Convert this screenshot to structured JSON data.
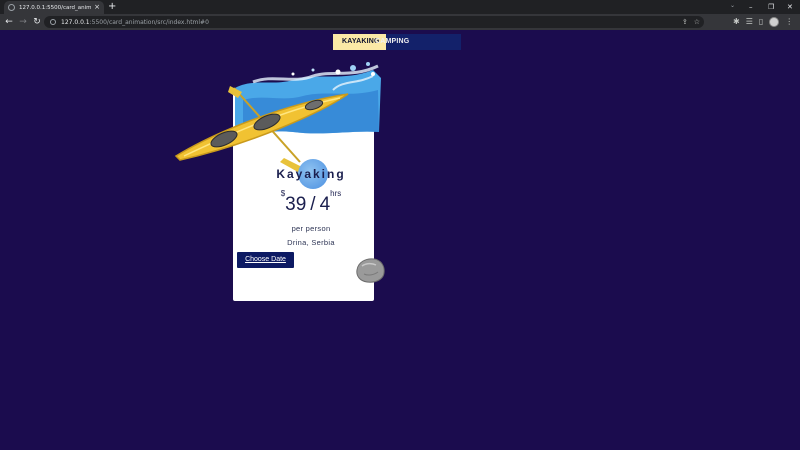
{
  "browser": {
    "tab_title": "127.0.0.1:5500/card_animation/s",
    "tab_close": "×",
    "new_tab": "+",
    "url_host": "127.0.0.1",
    "url_rest": ":5500/card_animation/src/index.html#0",
    "window_controls": {
      "minimize": "–",
      "restore": "❐",
      "close": "✕"
    }
  },
  "nav": {
    "tabs": [
      {
        "label": "KAYAKING"
      },
      {
        "label": "CAMPING"
      }
    ]
  },
  "card": {
    "title": "Kayaking",
    "price_currency": "$",
    "price_amount": "39",
    "price_duration": "4",
    "price_unit": "hrs",
    "per_text": "per person",
    "location": "Drina, Serbia",
    "button_label": "Choose Date"
  },
  "colors": {
    "page_background": "#1b0c4e",
    "nav_active": "#fbe9a6",
    "nav_inactive": "#13216a",
    "button": "#0d1a63",
    "kayak": "#f1c232",
    "splash": "#4aa8e8"
  },
  "icons": {
    "tab_favicon": "globe-icon",
    "back": "arrow-left-icon",
    "forward": "arrow-right-icon",
    "reload": "reload-icon",
    "security": "info-icon",
    "share": "share-icon",
    "bookmark": "star-icon",
    "extensions": "puzzle-icon",
    "media": "playlist-icon",
    "sidebar": "sidebar-icon",
    "profile": "avatar",
    "menu": "kebab-menu-icon"
  }
}
